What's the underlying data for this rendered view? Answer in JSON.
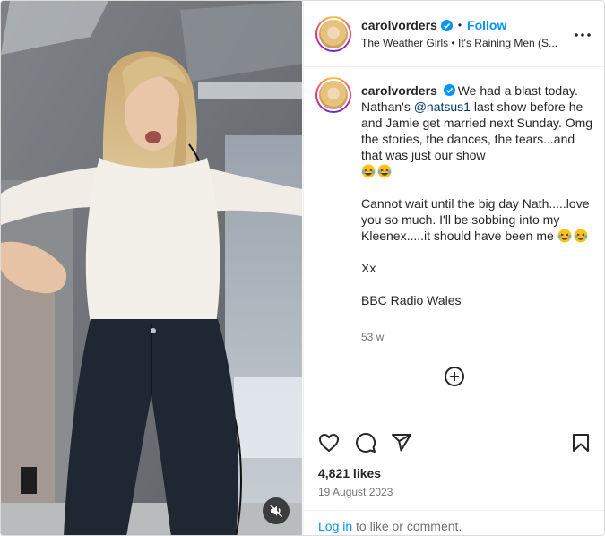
{
  "post": {
    "username": "carolvorders",
    "follow_label": "Follow",
    "separator": "•",
    "audio": "The Weather Girls • It's Raining Men (S...",
    "caption": {
      "line1_before": "We had a blast today. Nathan's ",
      "mention": "@natsus1",
      "line1_after": " last show before he and Jamie get married next Sunday. Omg the stories, the dances, the tears...and that was just our show",
      "para2": "Cannot wait until the big day Nath.....love you so much. I'll be sobbing into my Kleenex.....it should have been me",
      "para3": "Xx",
      "para4": "BBC Radio Wales"
    },
    "time_ago": "53 w",
    "likes": "4,821 likes",
    "date": "19 August 2023"
  },
  "footer": {
    "login_link": "Log in",
    "login_text": " to like or comment."
  },
  "icons": {
    "verified": "verified-badge-icon",
    "more": "more-options-icon",
    "emoji": "laughing-tears-emoji",
    "load_more": "plus-circle-icon",
    "like": "heart-icon",
    "comment": "comment-bubble-icon",
    "share": "share-paper-plane-icon",
    "save": "bookmark-icon",
    "mute": "speaker-muted-icon"
  },
  "colors": {
    "accent": "#0095f6",
    "mention": "#00376b",
    "secondary_text": "#737373",
    "primary_text": "#262626"
  }
}
